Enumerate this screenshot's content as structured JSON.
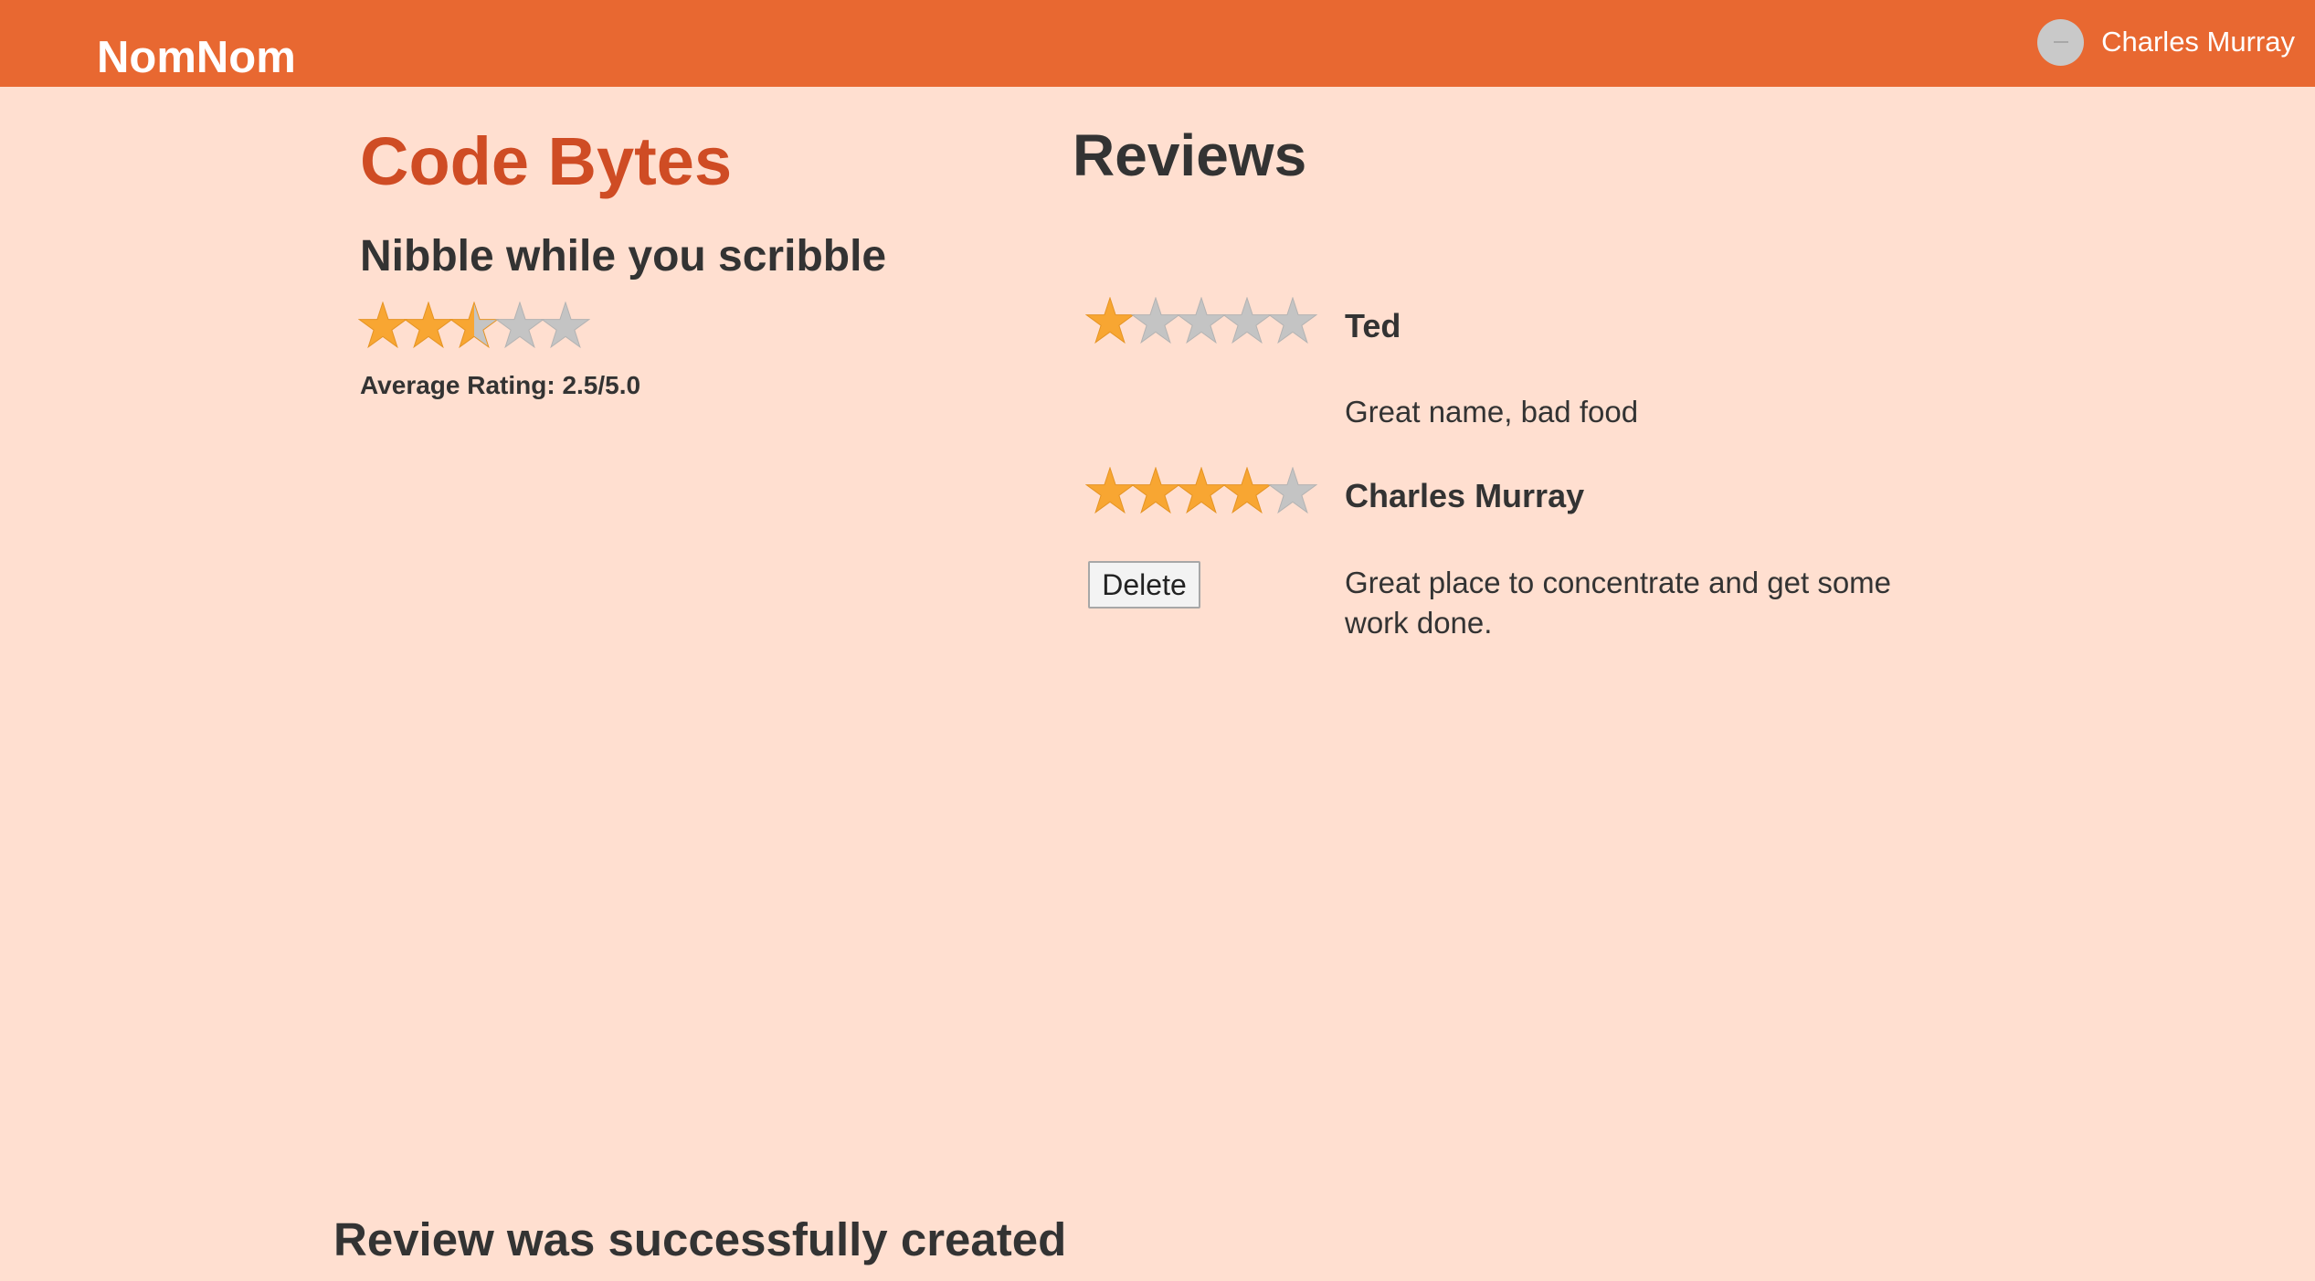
{
  "navbar": {
    "brand": "NomNom",
    "user_name": "Charles Murray",
    "color": "#e86831"
  },
  "restaurant": {
    "name": "Code Bytes",
    "tagline": "Nibble while you scribble",
    "average_rating": 2.5,
    "average_label": "Average Rating: 2.5/5.0",
    "name_color": "#cf4c24"
  },
  "reviews": {
    "heading": "Reviews",
    "items": [
      {
        "author": "Ted",
        "rating": 1,
        "body": "Great name, bad food"
      },
      {
        "author": "Charles Murray",
        "rating": 4,
        "body": "Great place to concentrate and get some work done.",
        "delete_label": "Delete"
      }
    ]
  },
  "flash": {
    "message": "Review was successfully created"
  },
  "colors": {
    "background": "#ffdfd0",
    "star_filled": "#f8a632",
    "star_empty": "#c4c4c4"
  }
}
